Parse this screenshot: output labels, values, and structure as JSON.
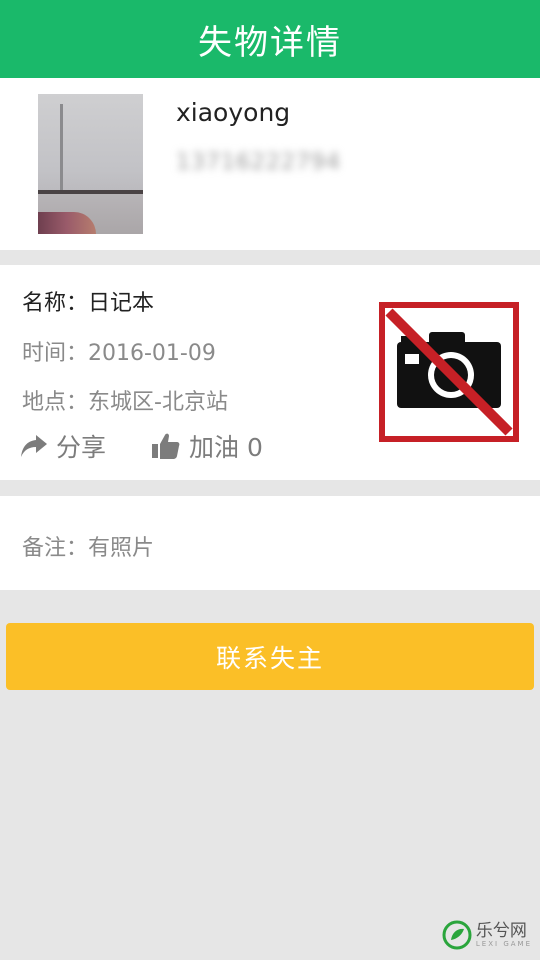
{
  "header": {
    "title": "失物详情"
  },
  "user": {
    "name": "xiaoyong",
    "phone": "13716222794"
  },
  "item": {
    "name_line": "名称：日记本",
    "time_line": "时间：2016-01-09",
    "place_line": "地点：东城区-北京站",
    "share_label": "分享",
    "cheer_label": "加油 0",
    "image_icon": "no-photo-icon",
    "image_color": "#c62026"
  },
  "note": {
    "text": "备注：有照片"
  },
  "contact_button": {
    "label": "联系失主"
  },
  "watermark": {
    "cn": "乐兮网",
    "en": "LEXI GAME"
  }
}
